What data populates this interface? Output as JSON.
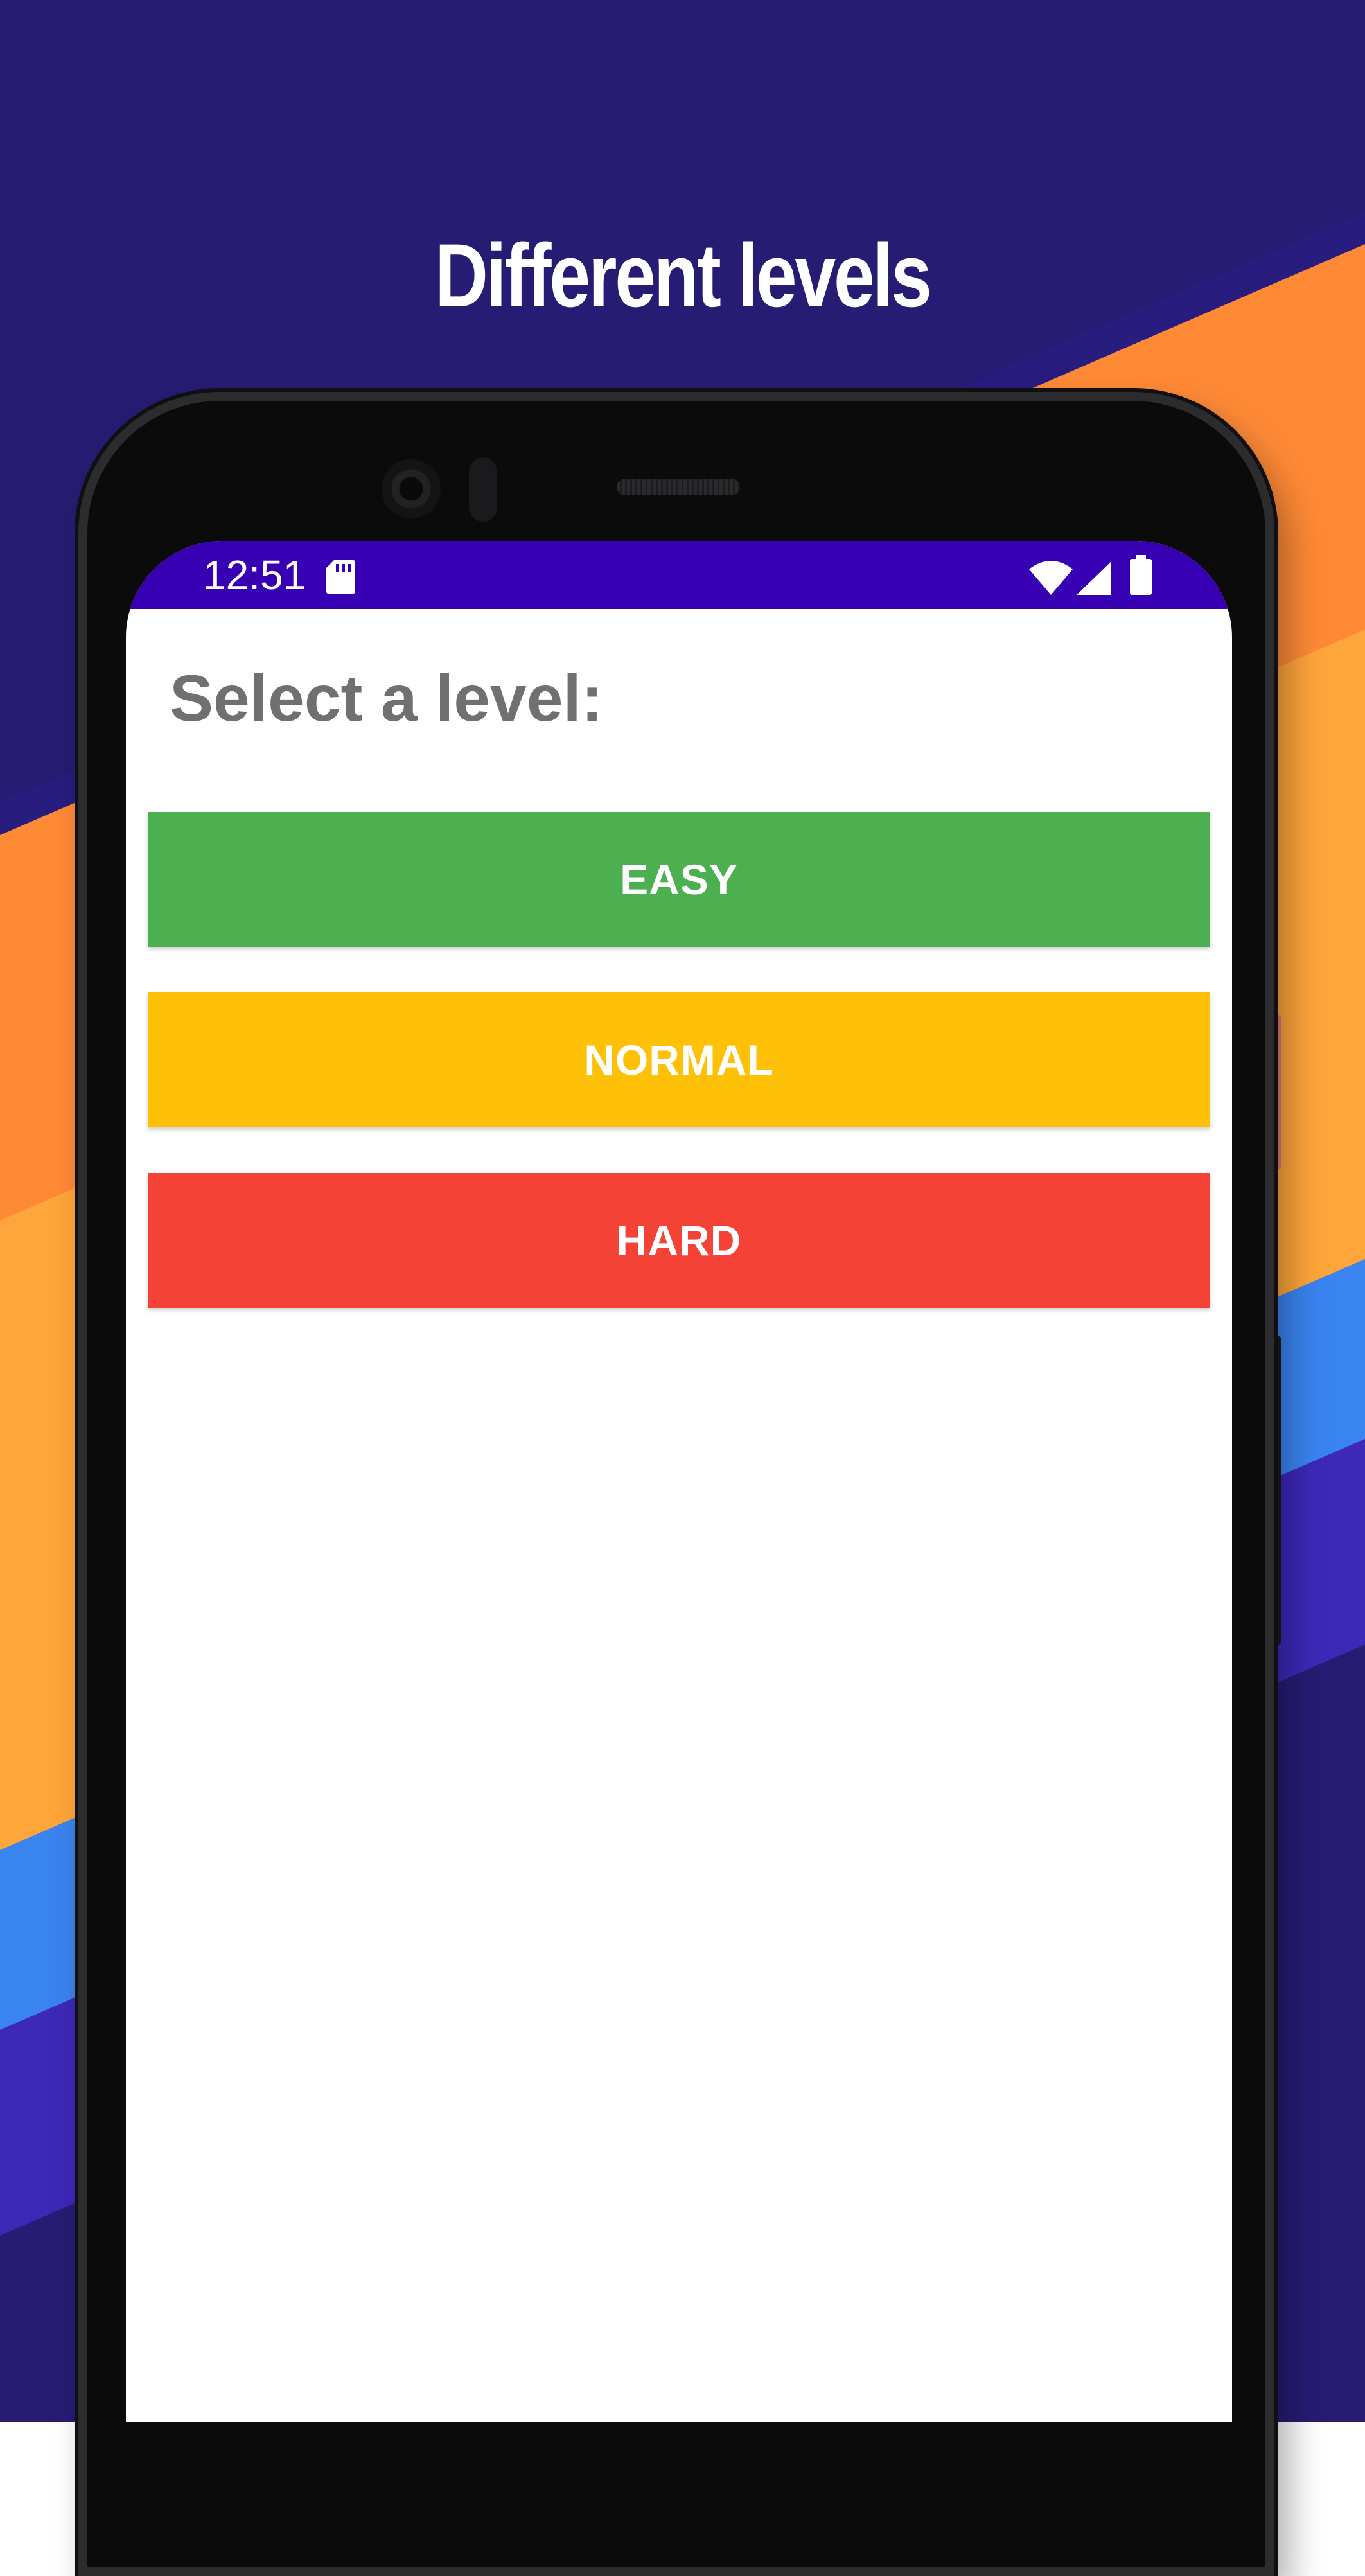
{
  "promo": {
    "headline": "Different levels",
    "colors": {
      "background": "#261c73",
      "stripe_orange": "#ff8a36",
      "stripe_light_orange": "#ffa63a",
      "stripe_blue": "#3a84f0",
      "stripe_violet": "#3d28b8"
    }
  },
  "status_bar": {
    "time": "12:51",
    "color": "#3700b3",
    "icons": [
      "sd-card-icon",
      "wifi-icon",
      "cell-signal-icon",
      "battery-icon"
    ]
  },
  "screen": {
    "title": "Select a level:",
    "levels": [
      {
        "label": "EASY",
        "color": "#4caf50"
      },
      {
        "label": "NORMAL",
        "color": "#ffc107"
      },
      {
        "label": "HARD",
        "color": "#f44336"
      }
    ]
  }
}
